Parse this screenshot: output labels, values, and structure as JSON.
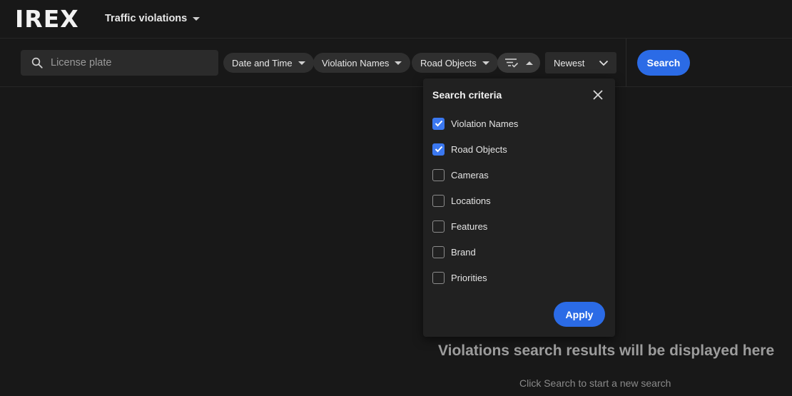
{
  "header": {
    "logo_text": "IREX",
    "app_name": "Traffic violations",
    "accent_color": "#d8262f"
  },
  "filters": {
    "search_placeholder": "License plate",
    "search_value": "",
    "chips": [
      {
        "label": "Date and Time"
      },
      {
        "label": "Violation Names"
      },
      {
        "label": "Road Objects"
      }
    ],
    "criteria_toggle_icon": "filter-list-check-icon",
    "sort": {
      "selected": "Newest"
    },
    "search_button": "Search",
    "primary_color": "#2b6be6"
  },
  "criteria_popup": {
    "title": "Search criteria",
    "items": [
      {
        "label": "Violation Names",
        "checked": true
      },
      {
        "label": "Road Objects",
        "checked": true
      },
      {
        "label": "Cameras",
        "checked": false
      },
      {
        "label": "Locations",
        "checked": false
      },
      {
        "label": "Features",
        "checked": false
      },
      {
        "label": "Brand",
        "checked": false
      },
      {
        "label": "Priorities",
        "checked": false
      }
    ],
    "apply_button": "Apply"
  },
  "empty_state": {
    "title": "Violations search results will be displayed here",
    "subtitle": "Click Search to start a new search"
  }
}
